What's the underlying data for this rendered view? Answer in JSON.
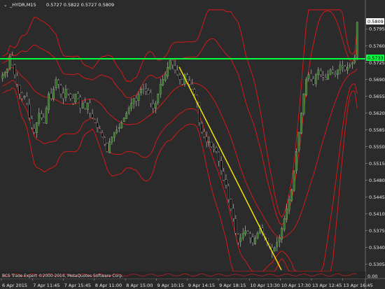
{
  "window": {
    "symbol": "_HYDR,M15",
    "ohlc": "0.5727 0.5822 0.5727 0.5809"
  },
  "copyright": "BCS Trade Expert ©2000-2014, MetaQuotes Software Corp.",
  "price_axis": {
    "ticks": [
      "0.5795",
      "0.5760",
      "0.5725",
      "0.5690",
      "0.5655",
      "0.5620",
      "0.5585",
      "0.5550",
      "0.5515",
      "0.5480",
      "0.5445",
      "0.5410",
      "0.5375",
      "0.5340",
      "0.5305"
    ],
    "current_price": "0.5809",
    "level_price": "0.5733",
    "bottom_zero": "0.00"
  },
  "time_axis": {
    "ticks": [
      "6 Apr 2015",
      "7 Apr 11:45",
      "7 Apr 15:45",
      "8 Apr 11:00",
      "8 Apr 15:00",
      "9 Apr 10:15",
      "9 Apr 14:15",
      "9 Apr 18:15",
      "10 Apr 13:30",
      "10 Apr 17:30",
      "13 Apr 12:45",
      "13 Apr 16:45"
    ]
  },
  "colors": {
    "background": "#2b2b2b",
    "bull_candle": "#2e7d1c",
    "bear_candle": "#0a0a0a",
    "bands": "#e21818",
    "level_line": "#00ff3c",
    "trend_line": "#ffee00",
    "current_price_tag": "#ffffff",
    "level_tag": "#00ff3c"
  },
  "chart_data": {
    "type": "candlestick",
    "symbol": "_HYDR",
    "timeframe": "M15",
    "ylim": [
      0.529,
      0.5835
    ],
    "horizontal_level": 0.5733,
    "trend_line": {
      "from": [
        0,
        0.5716
      ],
      "to": [
        1,
        0.5293
      ]
    },
    "close": [
      0.57,
      0.5705,
      0.5712,
      0.5738,
      0.572,
      0.57,
      0.568,
      0.566,
      0.565,
      0.5655,
      0.564,
      0.561,
      0.559,
      0.558,
      0.56,
      0.562,
      0.561,
      0.56,
      0.563,
      0.566,
      0.565,
      0.567,
      0.569,
      0.568,
      0.566,
      0.565,
      0.567,
      0.566,
      0.565,
      0.564,
      0.566,
      0.565,
      0.563,
      0.564,
      0.563,
      0.564,
      0.562,
      0.561,
      0.56,
      0.559,
      0.558,
      0.557,
      0.5555,
      0.554,
      0.556,
      0.557,
      0.558,
      0.5585,
      0.559,
      0.56,
      0.561,
      0.562,
      0.563,
      0.564,
      0.565,
      0.5645,
      0.566,
      0.567,
      0.567,
      0.5665,
      0.566,
      0.564,
      0.563,
      0.564,
      0.566,
      0.568,
      0.569,
      0.57,
      0.5715,
      0.573,
      0.572,
      0.571,
      0.57,
      0.569,
      0.568,
      0.57,
      0.569,
      0.568,
      0.567,
      0.566,
      0.564,
      0.56,
      0.558,
      0.557,
      0.556,
      0.556,
      0.555,
      0.5545,
      0.554,
      0.552,
      0.55,
      0.548,
      0.547,
      0.544,
      0.542,
      0.54,
      0.537,
      0.535,
      0.536,
      0.537,
      0.5375,
      0.537,
      0.536,
      0.535,
      0.536,
      0.537,
      0.538,
      0.537,
      0.536,
      0.535,
      0.534,
      0.533,
      0.534,
      0.535,
      0.536,
      0.538,
      0.54,
      0.542,
      0.544,
      0.546,
      0.55,
      0.554,
      0.558,
      0.562,
      0.566,
      0.569,
      0.57,
      0.569,
      0.568,
      0.57,
      0.571,
      0.57,
      0.5695,
      0.569,
      0.57,
      0.571,
      0.5705,
      0.57,
      0.571,
      0.572,
      0.5715,
      0.571,
      0.5715,
      0.572,
      0.5725,
      0.5735,
      0.5809
    ],
    "bands": {
      "period_note": "",
      "series": [
        "upper",
        "middle",
        "lower",
        "outer-upper",
        "outer-lower"
      ]
    }
  }
}
